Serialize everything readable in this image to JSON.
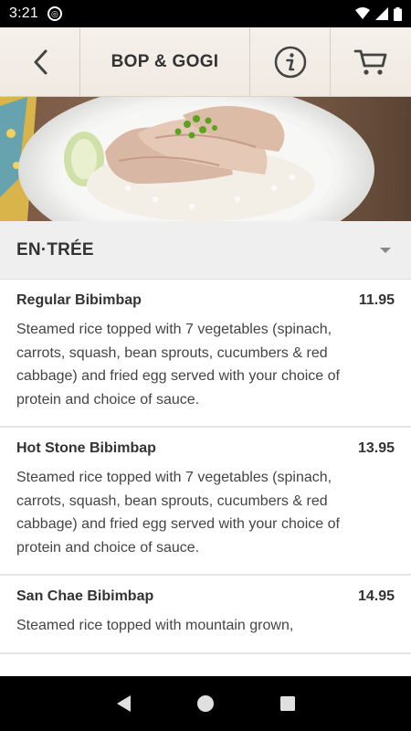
{
  "status_bar": {
    "time": "3:21"
  },
  "header": {
    "title": "BOP & GOGI"
  },
  "section": {
    "title": "EN·TRÉE"
  },
  "menu_items": [
    {
      "name": "Regular Bibimbap",
      "price": "11.95",
      "description": "Steamed rice topped with 7 vegetables (spinach, carrots, squash, bean sprouts, cucumbers & red cabbage) and fried egg served with your choice of protein and choice of sauce."
    },
    {
      "name": "Hot Stone Bibimbap",
      "price": "13.95",
      "description": "Steamed rice topped with 7 vegetables (spinach, carrots, squash, bean sprouts, cucumbers & red cabbage) and fried egg served with your choice of protein and choice of sauce."
    },
    {
      "name": "San Chae Bibimbap",
      "price": "14.95",
      "description": "Steamed rice topped with mountain grown,"
    }
  ],
  "icons": {
    "back": "chevron-left-icon",
    "info": "info-icon",
    "cart": "cart-icon",
    "nav_back": "triangle-back-icon",
    "nav_home": "circle-home-icon",
    "nav_recents": "square-recents-icon"
  },
  "colors": {
    "header_bg": "#f1ece5",
    "section_bg": "#efefef",
    "text": "#333333",
    "system_bar": "#000000"
  }
}
